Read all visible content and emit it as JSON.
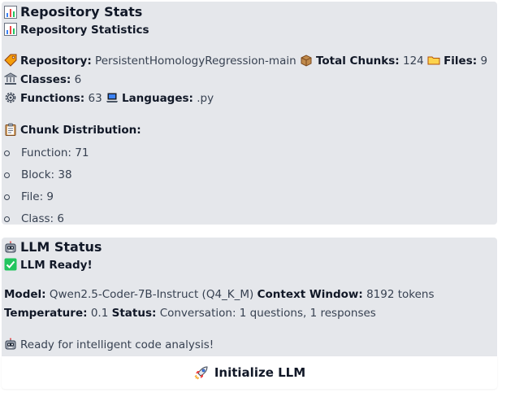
{
  "repo_stats": {
    "title": "Repository Stats",
    "subtitle": "Repository Statistics",
    "repository_label": "Repository:",
    "repository_value": "PersistentHomologyRegression-main",
    "total_chunks_label": "Total Chunks:",
    "total_chunks_value": "124",
    "files_label": "Files:",
    "files_value": "9",
    "classes_label": "Classes:",
    "classes_value": "6",
    "functions_label": "Functions:",
    "functions_value": "63",
    "languages_label": "Languages:",
    "languages_value": ".py",
    "chunk_distribution_label": "Chunk Distribution:",
    "chunks": [
      {
        "text": "Function: 71"
      },
      {
        "text": "Block: 38"
      },
      {
        "text": "File: 9"
      },
      {
        "text": "Class: 6"
      }
    ]
  },
  "llm_status": {
    "title": "LLM Status",
    "ready_text": "LLM Ready!",
    "model_label": "Model:",
    "model_value": "Qwen2.5-Coder-7B-Instruct (Q4_K_M)",
    "context_label": "Context Window:",
    "context_value": "8192 tokens",
    "temperature_label": "Temperature:",
    "temperature_value": "0.1",
    "status_label": "Status:",
    "status_value": "Conversation: 1 questions, 1 responses",
    "ready_message": "Ready for intelligent code analysis!"
  },
  "actions": {
    "init_label": "Initialize LLM"
  },
  "icons": {
    "stats": "bar-chart-icon",
    "tag": "tag-icon",
    "package": "package-icon",
    "folder": "folder-icon",
    "classes": "bank-icon",
    "functions": "gear-icon",
    "languages": "laptop-icon",
    "clipboard": "clipboard-icon",
    "robot": "robot-icon",
    "check": "check-mark-icon",
    "rocket": "rocket-icon"
  },
  "colors": {
    "panel_bg": "#e5e7eb",
    "check_green": "#22c55e",
    "text": "#374151"
  }
}
